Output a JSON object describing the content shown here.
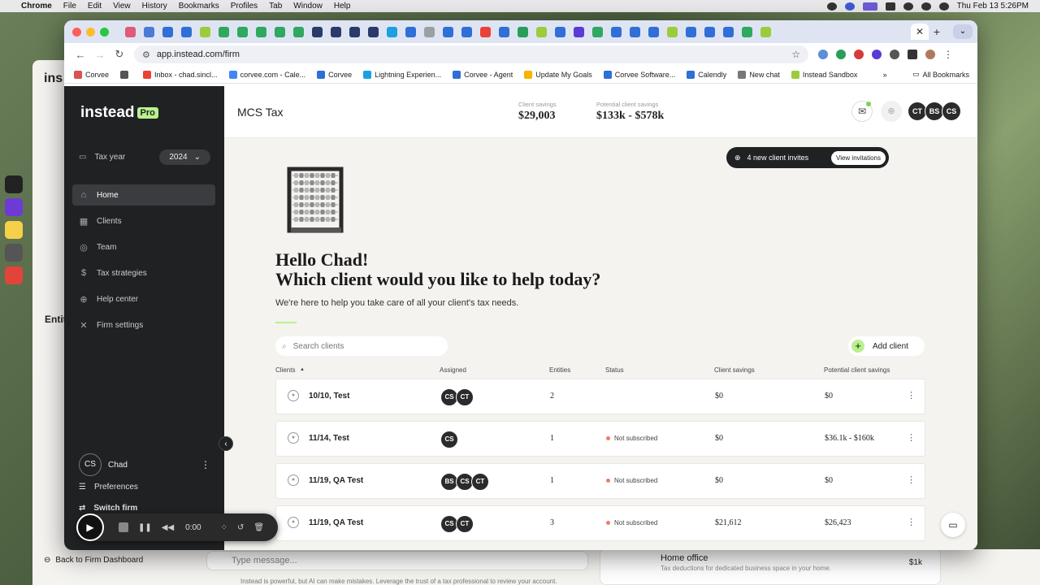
{
  "menubar": {
    "app": "Chrome",
    "items": [
      "File",
      "Edit",
      "View",
      "History",
      "Bookmarks",
      "Profiles",
      "Tab",
      "Window",
      "Help"
    ],
    "datetime": "Thu Feb 13  5:26PM"
  },
  "browser": {
    "url": "app.instead.com/firm",
    "bookmarks": [
      {
        "label": "Corvee",
        "color": "#d9534f"
      },
      {
        "label": "",
        "color": "#555555"
      },
      {
        "label": "Inbox - chad.sincl...",
        "color": "#ea4335"
      },
      {
        "label": "corvee.com - Cale...",
        "color": "#4285f4"
      },
      {
        "label": "Corvee",
        "color": "#2f6fd6"
      },
      {
        "label": "Lightning Experien...",
        "color": "#19a1e0"
      },
      {
        "label": "Corvee - Agent",
        "color": "#2f6fd6"
      },
      {
        "label": "Update My Goals",
        "color": "#f4b400"
      },
      {
        "label": "Corvee Software...",
        "color": "#2f6fd6"
      },
      {
        "label": "Calendly",
        "color": "#2f6fd6"
      },
      {
        "label": "New chat",
        "color": "#777777"
      },
      {
        "label": "Instead Sandbox",
        "color": "#9ccc3c"
      }
    ],
    "all_bookmarks": "All Bookmarks"
  },
  "sidebar": {
    "logo": "instead",
    "logo_badge": "Pro",
    "tax_year_label": "Tax year",
    "tax_year_value": "2024",
    "nav": [
      {
        "label": "Home",
        "icon": "home-icon",
        "glyph": "⌂",
        "active": true
      },
      {
        "label": "Clients",
        "icon": "clients-icon",
        "glyph": "▦",
        "active": false
      },
      {
        "label": "Team",
        "icon": "team-icon",
        "glyph": "◎",
        "active": false
      },
      {
        "label": "Tax strategies",
        "icon": "dollar-icon",
        "glyph": "$",
        "active": false
      },
      {
        "label": "Help center",
        "icon": "help-icon",
        "glyph": "⊕",
        "active": false
      },
      {
        "label": "Firm settings",
        "icon": "tools-icon",
        "glyph": "✕",
        "active": false
      }
    ],
    "user_initials": "CS",
    "user_name": "Chad",
    "preferences": "Preferences",
    "switch_firm": "Switch firm"
  },
  "topbar": {
    "firm_name": "MCS Tax",
    "client_savings_label": "Client savings",
    "client_savings_value": "$29,003",
    "potential_label": "Potential client savings",
    "potential_value": "$133k - $578k",
    "team_avatars": [
      "CT",
      "BS",
      "CS"
    ]
  },
  "invites": {
    "text": "4 new client invites",
    "button": "View invitations"
  },
  "hero": {
    "line1": "Hello Chad!",
    "line2": "Which client would you like to help today?",
    "subtitle": "We're here to help you take care of all your client's tax needs."
  },
  "search": {
    "placeholder": "Search clients"
  },
  "add_client": "Add client",
  "table": {
    "headers": [
      "Clients",
      "Assigned",
      "Entities",
      "Status",
      "Client savings",
      "Potential client savings"
    ],
    "rows": [
      {
        "name": "10/10, Test",
        "assigned": [
          "CS",
          "CT"
        ],
        "entities": "2",
        "status": "",
        "savings": "$0",
        "potential": "$0"
      },
      {
        "name": "11/14, Test",
        "assigned": [
          "CS"
        ],
        "entities": "1",
        "status": "Not subscribed",
        "savings": "$0",
        "potential": "$36.1k - $160k"
      },
      {
        "name": "11/19, QA Test",
        "assigned": [
          "BS",
          "CS",
          "CT"
        ],
        "entities": "1",
        "status": "Not subscribed",
        "savings": "$0",
        "potential": "$0"
      },
      {
        "name": "11/19, QA Test",
        "assigned": [
          "CS",
          "CT"
        ],
        "entities": "3",
        "status": "Not subscribed",
        "savings": "$21,612",
        "potential": "$26,423"
      }
    ]
  },
  "recorder": {
    "time": "0:00"
  },
  "background": {
    "title": "ins",
    "entities_label": "Entit",
    "back_link": "Back to Firm Dashboard",
    "chat_placeholder": "Type message...",
    "disclaimer": "Instead is powerful, but AI can make mistakes. Leverage the trust of a tax professional to review your account.",
    "card_title": "Home office",
    "card_sub": "Tax deductions for dedicated business space in your home.",
    "card_value": "$1k"
  },
  "colors": {
    "accent": "#b9f18d",
    "sidebar": "#1f2123",
    "status_dot": "#f07a6a"
  }
}
